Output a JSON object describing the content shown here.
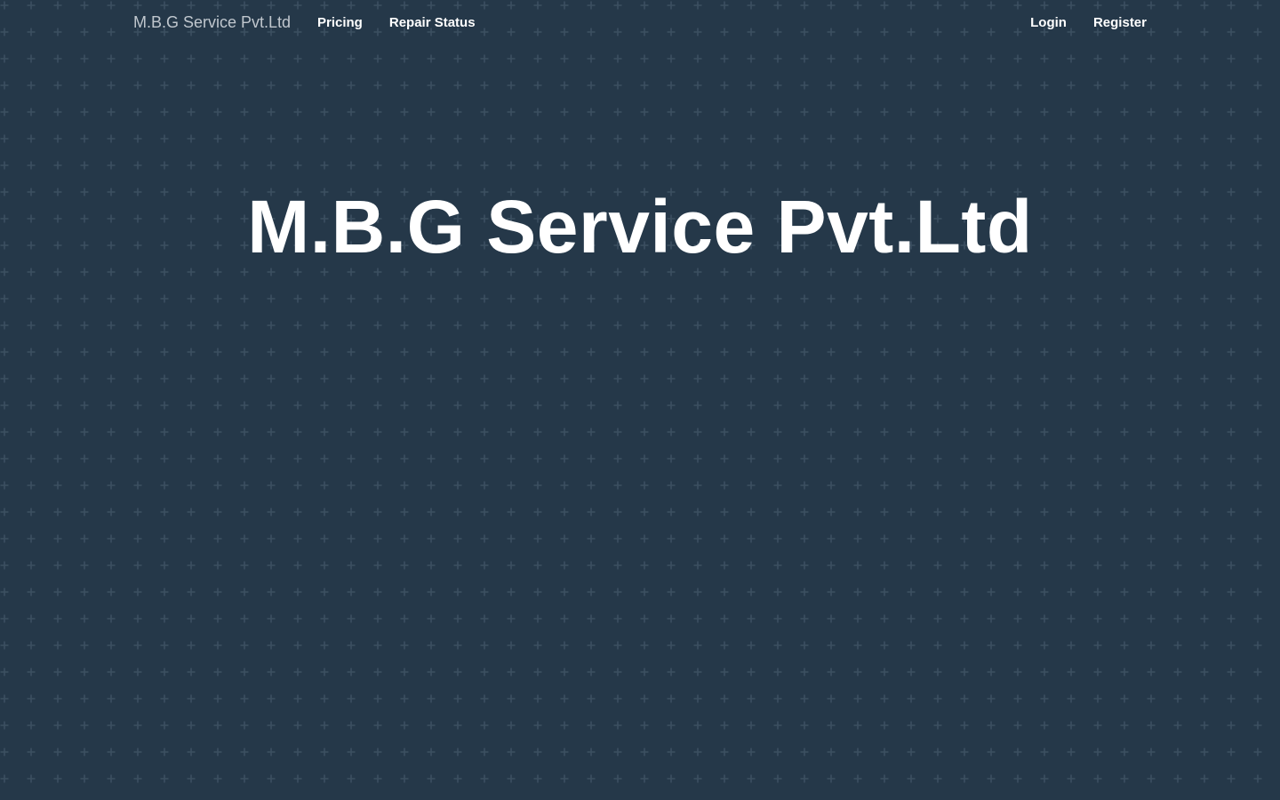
{
  "navbar": {
    "brand": "M.B.G Service Pvt.Ltd",
    "left_links": [
      "Pricing",
      "Repair Status"
    ],
    "right_links": [
      "Login",
      "Register"
    ]
  },
  "hero": {
    "title": "M.B.G Service Pvt.Ltd"
  },
  "colors": {
    "background": "#253849",
    "pattern": "#3a4d5e",
    "brand_text": "#c0c7ce",
    "link_text": "#ffffff"
  },
  "background_pattern": "plus-grid"
}
